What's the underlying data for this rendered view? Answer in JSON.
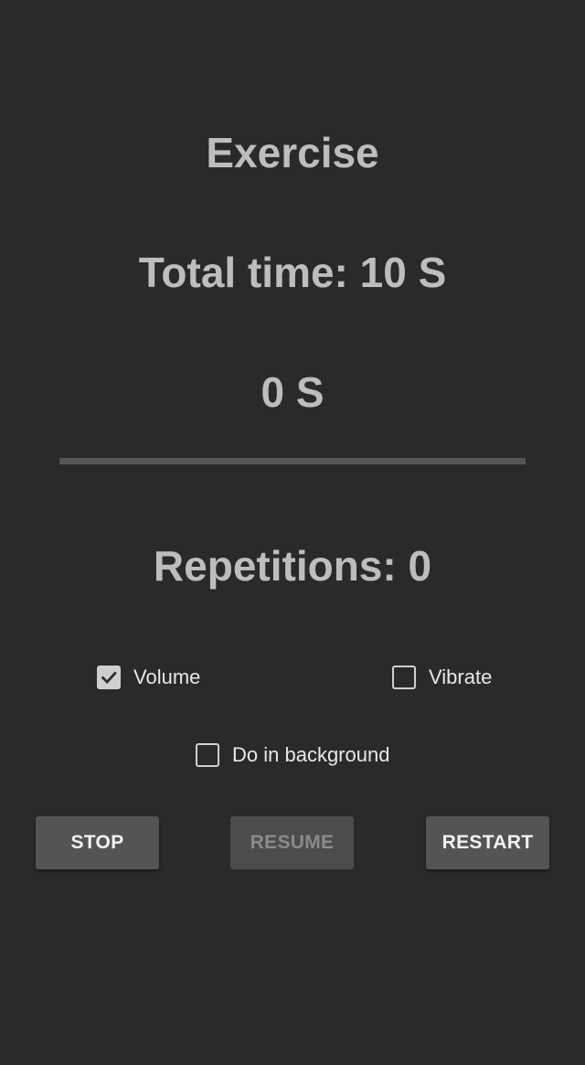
{
  "exercise": {
    "title": "Exercise",
    "total_time": "Total time: 10 S",
    "elapsed": "0 S",
    "repetitions": "Repetitions: 0",
    "progress_fraction": 0
  },
  "options": {
    "volume": {
      "label": "Volume",
      "checked": true
    },
    "vibrate": {
      "label": "Vibrate",
      "checked": false
    },
    "background": {
      "label": "Do in background",
      "checked": false
    }
  },
  "buttons": {
    "stop": "STOP",
    "resume": "RESUME",
    "restart": "RESTART"
  },
  "colors": {
    "background": "#2a2a2a",
    "text": "#bdbdbd",
    "button": "#545454",
    "button_disabled_text": "#8a8a8a"
  },
  "icons": {
    "checked": "check-icon"
  }
}
